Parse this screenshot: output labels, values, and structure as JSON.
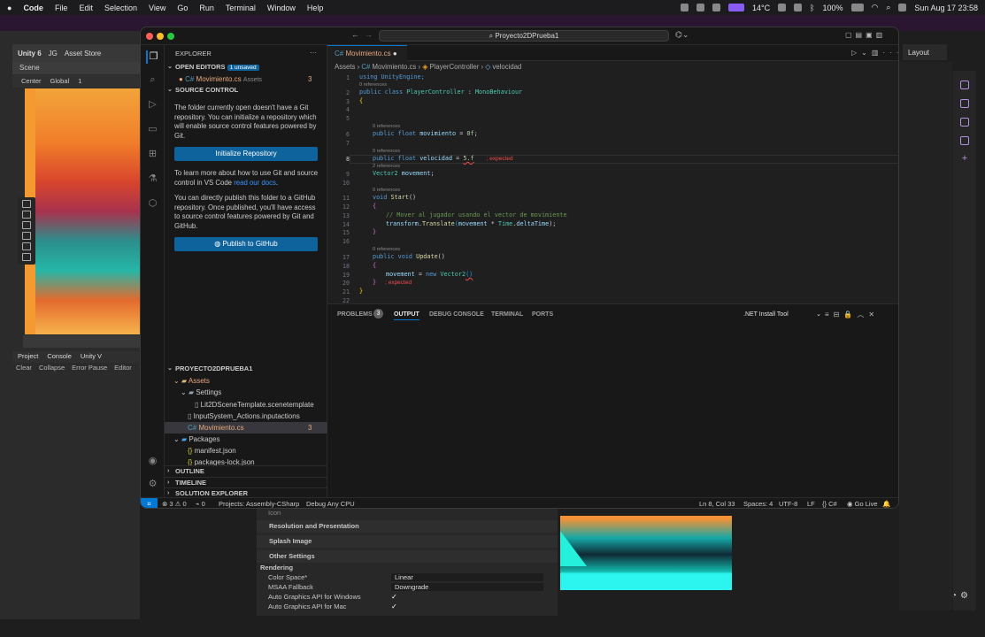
{
  "menubar": {
    "app": "Code",
    "items": [
      "File",
      "Edit",
      "Selection",
      "View",
      "Go",
      "Run",
      "Terminal",
      "Window",
      "Help"
    ],
    "weather": "14°C",
    "battery": "100%",
    "datetime": "Sun Aug 17  23:58"
  },
  "unity": {
    "title": "Unity 6",
    "account": "JG",
    "asset_store": "Asset Store",
    "scene_tab": "Scene",
    "pivot": "Center",
    "space": "Global",
    "grid_value": "1",
    "layout": "Layout",
    "tabs": [
      "Project",
      "Console",
      "Unity V"
    ],
    "console_bar": [
      "Clear",
      "Collapse",
      "Error Pause",
      "Editor"
    ],
    "inspector": {
      "icon_label": "Icon",
      "sections": [
        "Resolution and Presentation",
        "Splash Image",
        "Other Settings"
      ],
      "rendering_label": "Rendering",
      "rows": [
        {
          "label": "Color Space*",
          "value": "Linear"
        },
        {
          "label": "MSAA Fallback",
          "value": "Downgrade"
        },
        {
          "label": "Auto Graphics API for Windows",
          "value": "✓"
        },
        {
          "label": "Auto Graphics API for Mac",
          "value": "✓"
        }
      ]
    }
  },
  "vscode": {
    "search": "Proyecto2DPrueba1",
    "explorer_title": "EXPLORER",
    "open_editors": "OPEN EDITORS",
    "unsaved_badge": "1 unsaved",
    "open_file": "Movimiento.cs",
    "open_file_folder": "Assets",
    "open_file_count": "3",
    "source_control": "SOURCE CONTROL",
    "sc_text1": "The folder currently open doesn't have a Git repository. You can initialize a repository which will enable source control features powered by Git.",
    "init_button": "Initialize Repository",
    "sc_text2_a": "To learn more about how to use Git and source control in VS Code ",
    "sc_text2_link": "read our docs",
    "sc_text2_b": ".",
    "sc_text3": "You can directly publish this folder to a GitHub repository. Once published, you'll have access to source control features powered by Git and GitHub.",
    "publish_button": "Publish to GitHub",
    "project": "PROYECTO2DPRUEBA1",
    "tree": {
      "assets": "Assets",
      "settings": "Settings",
      "scenetemplate": "Lit2DSceneTemplate.scenetemplate",
      "inputactions": "InputSystem_Actions.inputactions",
      "movimiento": "Movimiento.cs",
      "movimiento_count": "3",
      "packages": "Packages",
      "manifest": "manifest.json",
      "packages_lock": "packages-lock.json"
    },
    "outline": "OUTLINE",
    "timeline": "TIMELINE",
    "solution": "SOLUTION EXPLORER",
    "tab_label": "Movimiento.cs",
    "breadcrumb": [
      "Assets",
      "Movimiento.cs",
      "PlayerController",
      "velocidad"
    ],
    "code": {
      "l1": "using UnityEngine;",
      "refs0": "0 references",
      "l2a": "public class ",
      "l2b": "PlayerController",
      "l2c": " : ",
      "l2d": "MonoBehaviour",
      "l3": "{",
      "l6a": "public float ",
      "l6b": "movimiento",
      "l6c": " = ",
      "l6d": "0f",
      "l6e": ";",
      "l8a": "public float ",
      "l8b": "velocidad",
      "l8c": " = ",
      "l8d": "5.f",
      "l8err": "; expected",
      "refs2": "2 references",
      "l9a": "Vector2",
      "l9b": " movement",
      "l9c": ";",
      "l11a": "void ",
      "l11b": "Start",
      "l11c": "()",
      "l12": "{",
      "l13": "// Mover al jugador usando el vector de movimiente",
      "l14a": "transform",
      "l14b": ".",
      "l14c": "Translate",
      "l14d": "(",
      "l14e": "movement",
      "l14f": " * ",
      "l14g": "Time",
      "l14h": ".",
      "l14i": "deltaTime",
      "l14j": ");",
      "l15": "}",
      "l17a": "public void ",
      "l17b": "Update",
      "l17c": "()",
      "l18": "{",
      "l19a": "movement",
      "l19b": " = ",
      "l19c": "new ",
      "l19d": "Vector2",
      "l19e": "()",
      "l20": "}",
      "l20err": "; expected",
      "l21": "}"
    },
    "line_numbers": [
      "1",
      "2",
      "3",
      "4",
      "5",
      "6",
      "7",
      "8",
      "9",
      "10",
      "11",
      "12",
      "13",
      "14",
      "15",
      "16",
      "17",
      "18",
      "19",
      "20",
      "21",
      "22"
    ],
    "panel_tabs": [
      "PROBLEMS",
      "OUTPUT",
      "DEBUG CONSOLE",
      "TERMINAL",
      "PORTS"
    ],
    "problems_count": "3",
    "output_source": ".NET Install Tool",
    "status": {
      "errors": "3",
      "warnings": "0",
      "info": "0",
      "projects": "Projects: Assembly-CSharp",
      "debug": "Debug Any CPU",
      "position": "Ln 8, Col 33",
      "spaces": "Spaces: 4",
      "encoding": "UTF-8",
      "eol": "LF",
      "language": "C#",
      "golive": "Go Live"
    }
  },
  "colors": {
    "accent": "#0078d4",
    "button": "#0e639c",
    "error": "#f14c4c",
    "modified_file": "#e8a87c"
  }
}
